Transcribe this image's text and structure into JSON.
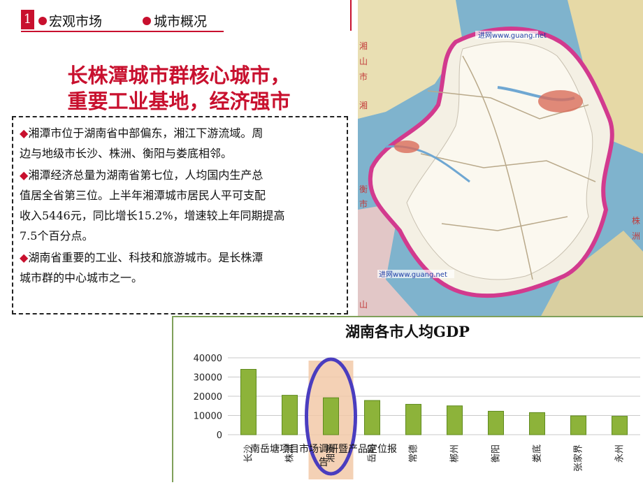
{
  "header": {
    "section_number": "1",
    "tab_macro": "宏观市场",
    "tab_city": "城市概况",
    "accent_color": "#c8102e"
  },
  "headline": {
    "line1": "长株潭城市群核心城市，",
    "line2": "重要工业基地，经济强市"
  },
  "body": {
    "bullet_symbol": "◆",
    "paragraphs": [
      [
        "湘潭市位于湖南省中部偏东，湘江下游流域。周",
        "边与地级市长沙、株洲、衡阳与娄底相邻。"
      ],
      [
        "湘潭经济总量为湖南省第七位，人均国内生产总",
        "值居全省第三位。上半年湘潭城市居民人平可支配",
        "收入5446元，同比增长15.2%，增速较上年同期提高",
        "7.5个百分点。"
      ],
      [
        "湖南省重要的工业、科技和旅游城市。是长株潭",
        "城市群的中心城市之一。"
      ]
    ]
  },
  "map": {
    "watermark_top": "进网www.guang.net",
    "watermark_bottom": "进网www.guang.net",
    "side_labels": [
      "湘",
      "山",
      "市",
      "湘",
      "衡",
      "市",
      "山",
      "株",
      "洲"
    ]
  },
  "chart_data": {
    "type": "bar",
    "title": "湖南各市人均GDP",
    "categories": [
      "长沙",
      "株洲",
      "湘潭",
      "岳阳",
      "常德",
      "郴州",
      "衡阳",
      "娄底",
      "张家界",
      "永州"
    ],
    "values": [
      34000,
      20500,
      19200,
      17800,
      15800,
      15000,
      12200,
      11500,
      9800,
      9600
    ],
    "ylim": [
      0,
      40000
    ],
    "yticks": [
      "0",
      "10000",
      "20000",
      "30000",
      "40000"
    ],
    "highlight_index": 2,
    "bar_color": "#8db33a",
    "highlight_color": "#f2c9a8",
    "ellipse_color": "#4a3dbf",
    "grid": true
  },
  "footer": {
    "line1": "南岳塘项目市场调研暨产品定位报",
    "line2": "告"
  }
}
